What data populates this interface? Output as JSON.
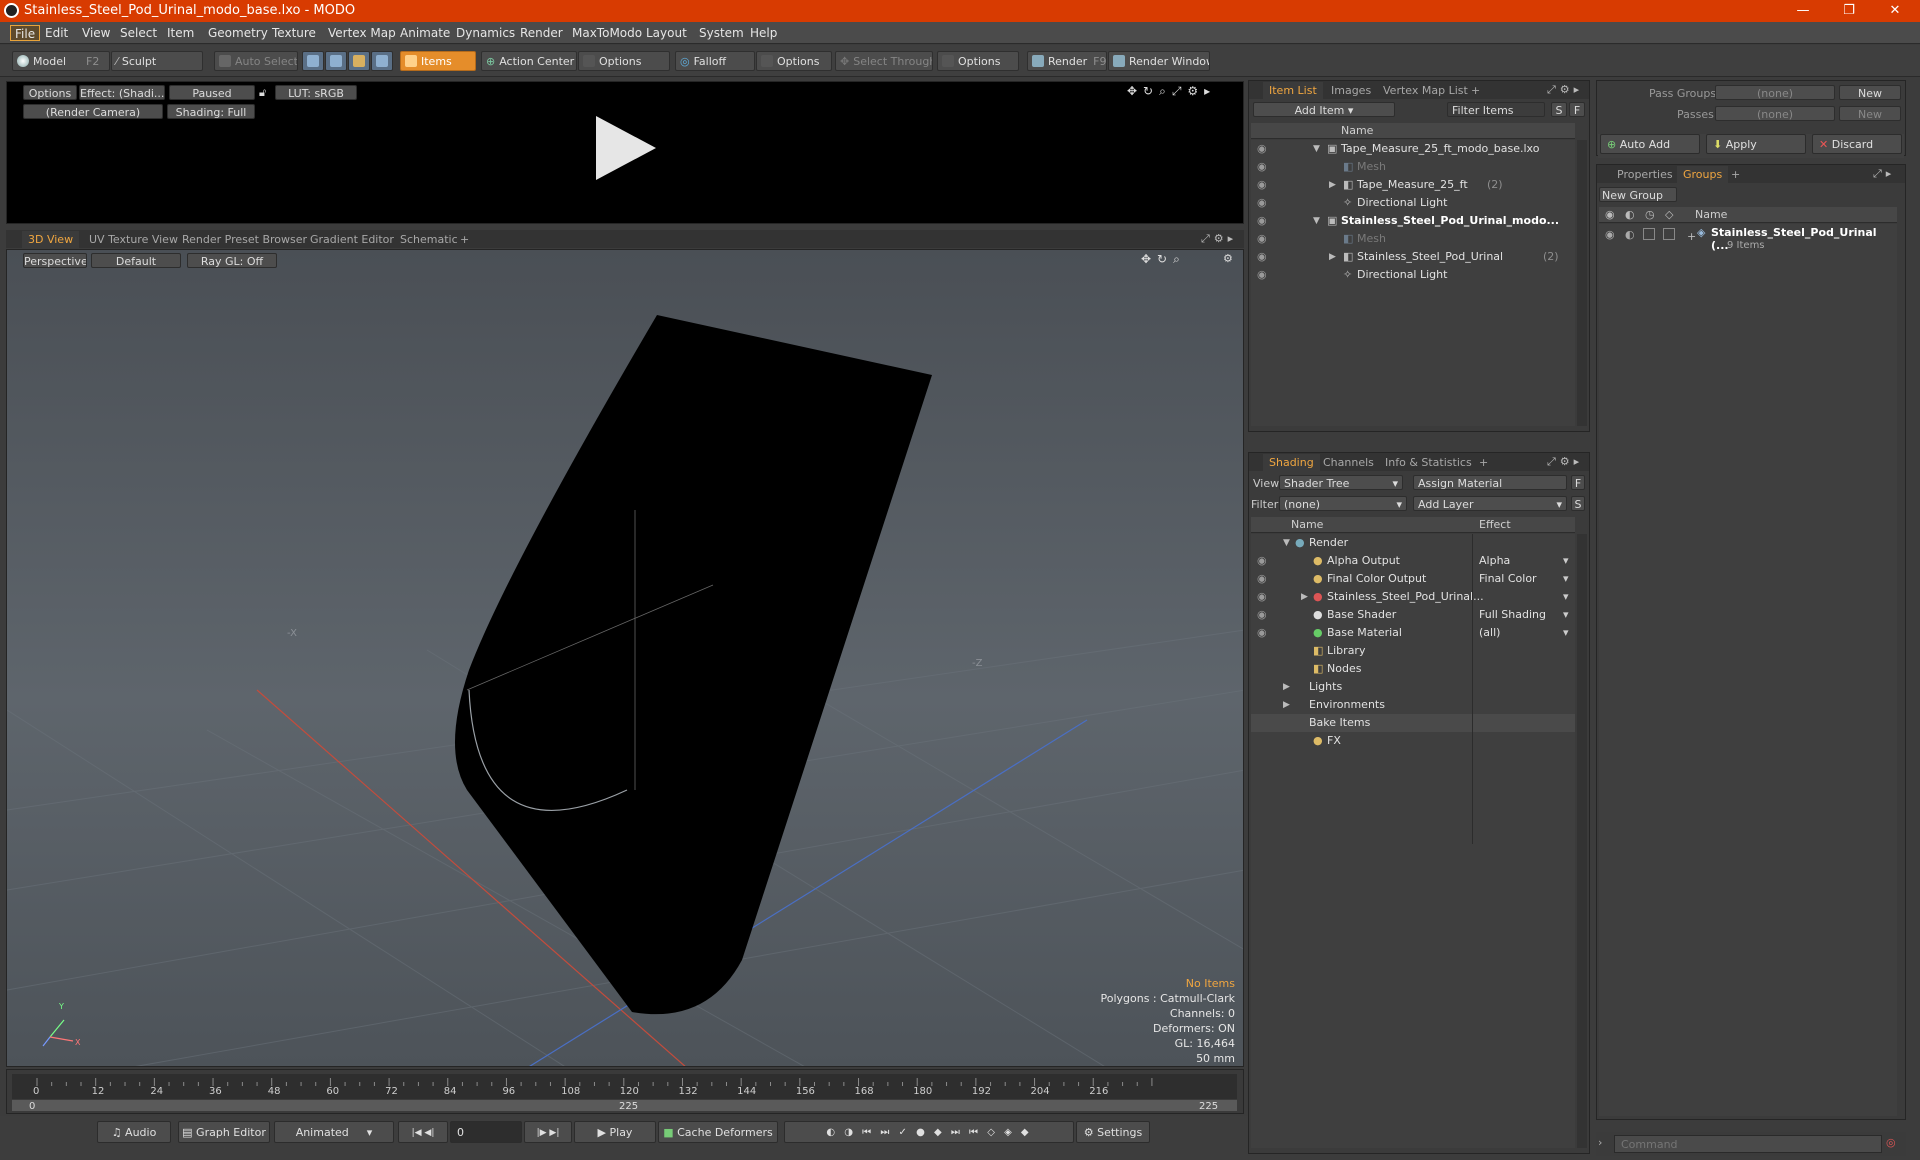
{
  "window": {
    "title": "Stainless_Steel_Pod_Urinal_modo_base.lxo - MODO",
    "minimize": "—",
    "maximize": "❐",
    "close": "✕"
  },
  "menu": [
    "File",
    "Edit",
    "View",
    "Select",
    "Item",
    "Geometry",
    "Texture",
    "Vertex Map",
    "Animate",
    "Dynamics",
    "Render",
    "MaxToModo",
    "Layout",
    "System",
    "Help"
  ],
  "toolbar": {
    "model": "Model",
    "model_key": "F2",
    "sculpt": "Sculpt",
    "auto_select": "Auto Select",
    "items": "Items",
    "action_center": "Action Center",
    "options1": "Options",
    "falloff": "Falloff",
    "options2": "Options",
    "select_through": "Select Through",
    "options3": "Options",
    "render": "Render",
    "render_key": "F9",
    "render_window": "Render Window"
  },
  "render_preview": {
    "options": "Options",
    "effect": "Effect: (Shadi...",
    "paused": "Paused",
    "lut": "LUT: sRGB",
    "camera": "(Render Camera)",
    "shading": "Shading: Full"
  },
  "viewport_tabs": [
    "3D View",
    "UV Texture View",
    "Render Preset Browser",
    "Gradient Editor",
    "Schematic",
    "+"
  ],
  "viewport": {
    "perspective": "Perspective",
    "default": "Default",
    "raygl": "Ray GL: Off",
    "axis_x": "-X",
    "axis_z": "-Z",
    "gizmo_y": "Y",
    "gizmo_x": "X",
    "info": {
      "no_items": "No Items",
      "polygons": "Polygons : Catmull-Clark",
      "channels": "Channels: 0",
      "deformers": "Deformers: ON",
      "gl": "GL: 16,464",
      "focal": "50 mm"
    }
  },
  "timeline": {
    "ticks": [
      "0",
      "12",
      "24",
      "36",
      "48",
      "60",
      "72",
      "84",
      "96",
      "108",
      "120",
      "132",
      "144",
      "156",
      "168",
      "180",
      "192",
      "204",
      "216"
    ],
    "range_start": "0",
    "range_mid": "225",
    "range_end": "225"
  },
  "bottombar": {
    "audio": "Audio",
    "graph_editor": "Graph Editor",
    "animated": "Animated",
    "frame": "0",
    "play": "Play",
    "cache_deformers": "Cache Deformers",
    "settings": "Settings"
  },
  "item_list": {
    "tabs": [
      "Item List",
      "Images",
      "Vertex Map List",
      "+"
    ],
    "add_item": "Add Item",
    "filter_items": "Filter Items",
    "s": "S",
    "f": "F",
    "name_header": "Name",
    "rows": [
      {
        "label": "Tape_Measure_25_ft_modo_base.lxo",
        "indent": 0,
        "expanded": true,
        "bold": false
      },
      {
        "label": "Mesh",
        "indent": 1,
        "dim": true
      },
      {
        "label": "Tape_Measure_25_ft",
        "count": "(2)",
        "indent": 1,
        "collapsed": true
      },
      {
        "label": "Directional Light",
        "indent": 1
      },
      {
        "label": "Stainless_Steel_Pod_Urinal_modo...",
        "indent": 0,
        "expanded": true,
        "bold": true
      },
      {
        "label": "Mesh",
        "indent": 1,
        "dim": true
      },
      {
        "label": "Stainless_Steel_Pod_Urinal",
        "count": "(2)",
        "indent": 1,
        "collapsed": true
      },
      {
        "label": "Directional Light",
        "indent": 1
      }
    ]
  },
  "shading": {
    "tabs": [
      "Shading",
      "Channels",
      "Info & Statistics",
      "+"
    ],
    "view_label": "View",
    "view_value": "Shader Tree",
    "assign_material": "Assign Material",
    "f": "F",
    "filter_label": "Filter",
    "filter_value": "(none)",
    "add_layer": "Add Layer",
    "s": "S",
    "name_header": "Name",
    "effect_header": "Effect",
    "rows": [
      {
        "label": "Render",
        "effect": "",
        "indent": 0,
        "eye": false
      },
      {
        "label": "Alpha Output",
        "effect": "Alpha",
        "indent": 1,
        "eye": true
      },
      {
        "label": "Final Color Output",
        "effect": "Final Color",
        "indent": 1,
        "eye": true
      },
      {
        "label": "Stainless_Steel_Pod_Urinal...",
        "effect": "",
        "indent": 1,
        "eye": true
      },
      {
        "label": "Base Shader",
        "effect": "Full Shading",
        "indent": 1,
        "eye": true
      },
      {
        "label": "Base Material",
        "effect": "(all)",
        "indent": 1,
        "eye": true
      },
      {
        "label": "Library",
        "effect": "",
        "indent": 1,
        "eye": false
      },
      {
        "label": "Nodes",
        "effect": "",
        "indent": 1,
        "eye": false
      },
      {
        "label": "Lights",
        "effect": "",
        "indent": 0,
        "eye": false
      },
      {
        "label": "Environments",
        "effect": "",
        "indent": 0,
        "eye": false
      },
      {
        "label": "Bake Items",
        "effect": "",
        "indent": 0,
        "eye": false
      },
      {
        "label": "FX",
        "effect": "",
        "indent": 1,
        "eye": false
      }
    ]
  },
  "groups_panel": {
    "pass_groups": "Pass Groups",
    "pass_groups_value": "(none)",
    "new1": "New",
    "passes": "Passes",
    "passes_value": "(none)",
    "new2": "New",
    "auto_add": "Auto Add",
    "apply": "Apply",
    "discard": "Discard",
    "tabs": [
      "Properties",
      "Groups",
      "+"
    ],
    "new_group": "New Group",
    "name_header": "Name",
    "group_name": "Stainless_Steel_Pod_Urinal (...",
    "group_count": "9 Items"
  },
  "command": {
    "placeholder": "Command"
  }
}
